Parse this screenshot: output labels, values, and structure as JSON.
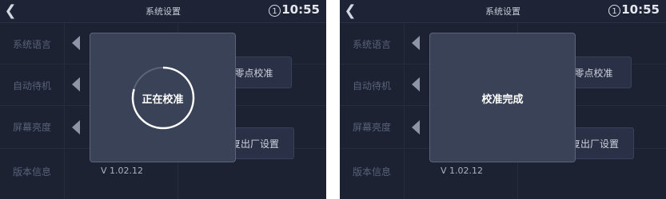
{
  "screens": [
    {
      "header": {
        "title": "系统设置",
        "badge": "1",
        "time": "10:55"
      },
      "sidebar": {
        "items": [
          "系统语言",
          "自动待机",
          "屏幕亮度",
          "版本信息"
        ]
      },
      "options": {
        "zero_cal": "零点校准",
        "factory_reset": "恢复出厂设置"
      },
      "version": "V 1.02.12",
      "modal": {
        "text": "正在校准",
        "state": "calibrating"
      }
    },
    {
      "header": {
        "title": "系统设置",
        "badge": "1",
        "time": "10:55"
      },
      "sidebar": {
        "items": [
          "系统语言",
          "自动待机",
          "屏幕亮度",
          "版本信息"
        ]
      },
      "options": {
        "zero_cal": "零点校准",
        "factory_reset": "恢复出厂设置"
      },
      "version": "V 1.02.12",
      "modal": {
        "text": "校准完成",
        "state": "done"
      }
    }
  ],
  "colors": {
    "background": "#1c2232",
    "modal": "#3a4257",
    "text": "#ffffff"
  }
}
